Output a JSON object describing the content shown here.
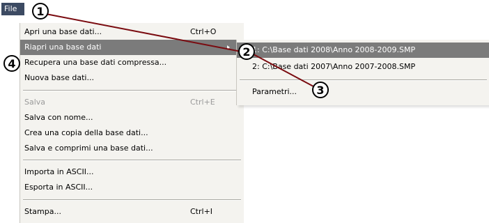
{
  "menubar": {
    "file_label": "File"
  },
  "file_menu": {
    "items": [
      {
        "label": "Apri una base dati...",
        "shortcut": "Ctrl+O"
      },
      {
        "label": "Riapri una base dati",
        "shortcut": ""
      },
      {
        "label": "Recupera una base dati compressa...",
        "shortcut": ""
      },
      {
        "label": "Nuova base dati...",
        "shortcut": ""
      },
      {
        "label": "Salva",
        "shortcut": "Ctrl+E"
      },
      {
        "label": "Salva con nome...",
        "shortcut": ""
      },
      {
        "label": "Crea una copia della base dati...",
        "shortcut": ""
      },
      {
        "label": "Salva e comprimi una base dati...",
        "shortcut": ""
      },
      {
        "label": "Importa in ASCII...",
        "shortcut": ""
      },
      {
        "label": "Esporta in ASCII...",
        "shortcut": ""
      },
      {
        "label": "Stampa...",
        "shortcut": "Ctrl+I"
      }
    ]
  },
  "recent_submenu": {
    "items": [
      {
        "label": "1: C:\\Base dati 2008\\Anno 2008-2009.SMP"
      },
      {
        "label": "2: C:\\Base dati 2007\\Anno 2007-2008.SMP"
      },
      {
        "label": "Parametri..."
      }
    ]
  },
  "callouts": [
    "1",
    "2",
    "3",
    "4"
  ],
  "colors": {
    "highlight": "#7b7b7b",
    "menu_bg": "#f4f3ef",
    "callout_line": "#7a0b10"
  }
}
